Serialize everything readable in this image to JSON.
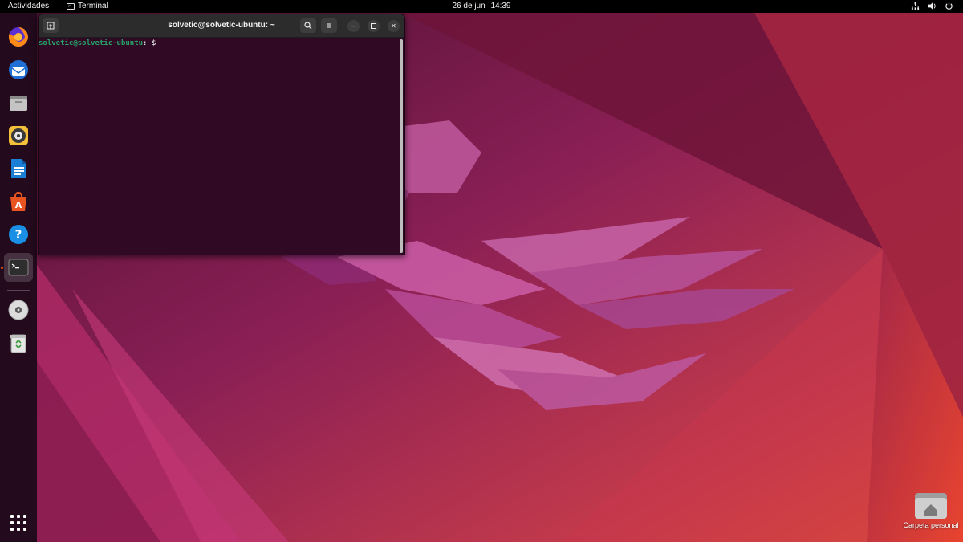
{
  "topbar": {
    "activities": "Actividades",
    "app_menu": "Terminal",
    "clock_date": "26 de jun",
    "clock_time": "14:39",
    "tray_icons": [
      "network-icon",
      "volume-icon",
      "power-icon"
    ]
  },
  "dock": {
    "items": [
      {
        "name": "Firefox",
        "icon": "firefox-icon"
      },
      {
        "name": "Thunderbird",
        "icon": "thunderbird-icon"
      },
      {
        "name": "Files",
        "icon": "files-icon"
      },
      {
        "name": "Rhythmbox",
        "icon": "rhythmbox-icon"
      },
      {
        "name": "LibreOffice Writer",
        "icon": "writer-icon"
      },
      {
        "name": "Ubuntu Software",
        "icon": "software-icon"
      },
      {
        "name": "Help",
        "icon": "help-icon"
      },
      {
        "name": "Terminal",
        "icon": "terminal-icon",
        "active": true
      },
      {
        "name": "Disc",
        "icon": "disc-icon"
      },
      {
        "name": "Trash",
        "icon": "trash-icon"
      }
    ],
    "show_apps_icon": "apps-grid-icon"
  },
  "terminal": {
    "title": "solvetic@solvetic-ubuntu: ~",
    "prompt_user": "solvetic@solvetic-ubuntu",
    "prompt_colon": ":",
    "prompt_path": " ",
    "prompt_dollar": "$",
    "buttons": {
      "new_tab_icon": "new-tab-icon",
      "search_icon": "search-icon",
      "menu_icon": "hamburger-menu-icon",
      "minimize_label": "–",
      "maximize_icon": "maximize-icon",
      "close_label": "✕"
    }
  },
  "desktop": {
    "home_folder_label": "Carpeta personal"
  },
  "colors": {
    "topbar_bg": "#000000",
    "dock_bg": "#230a1c",
    "terminal_bg": "#300a24",
    "prompt_green": "#26a269",
    "accent_orange": "#e95420"
  }
}
